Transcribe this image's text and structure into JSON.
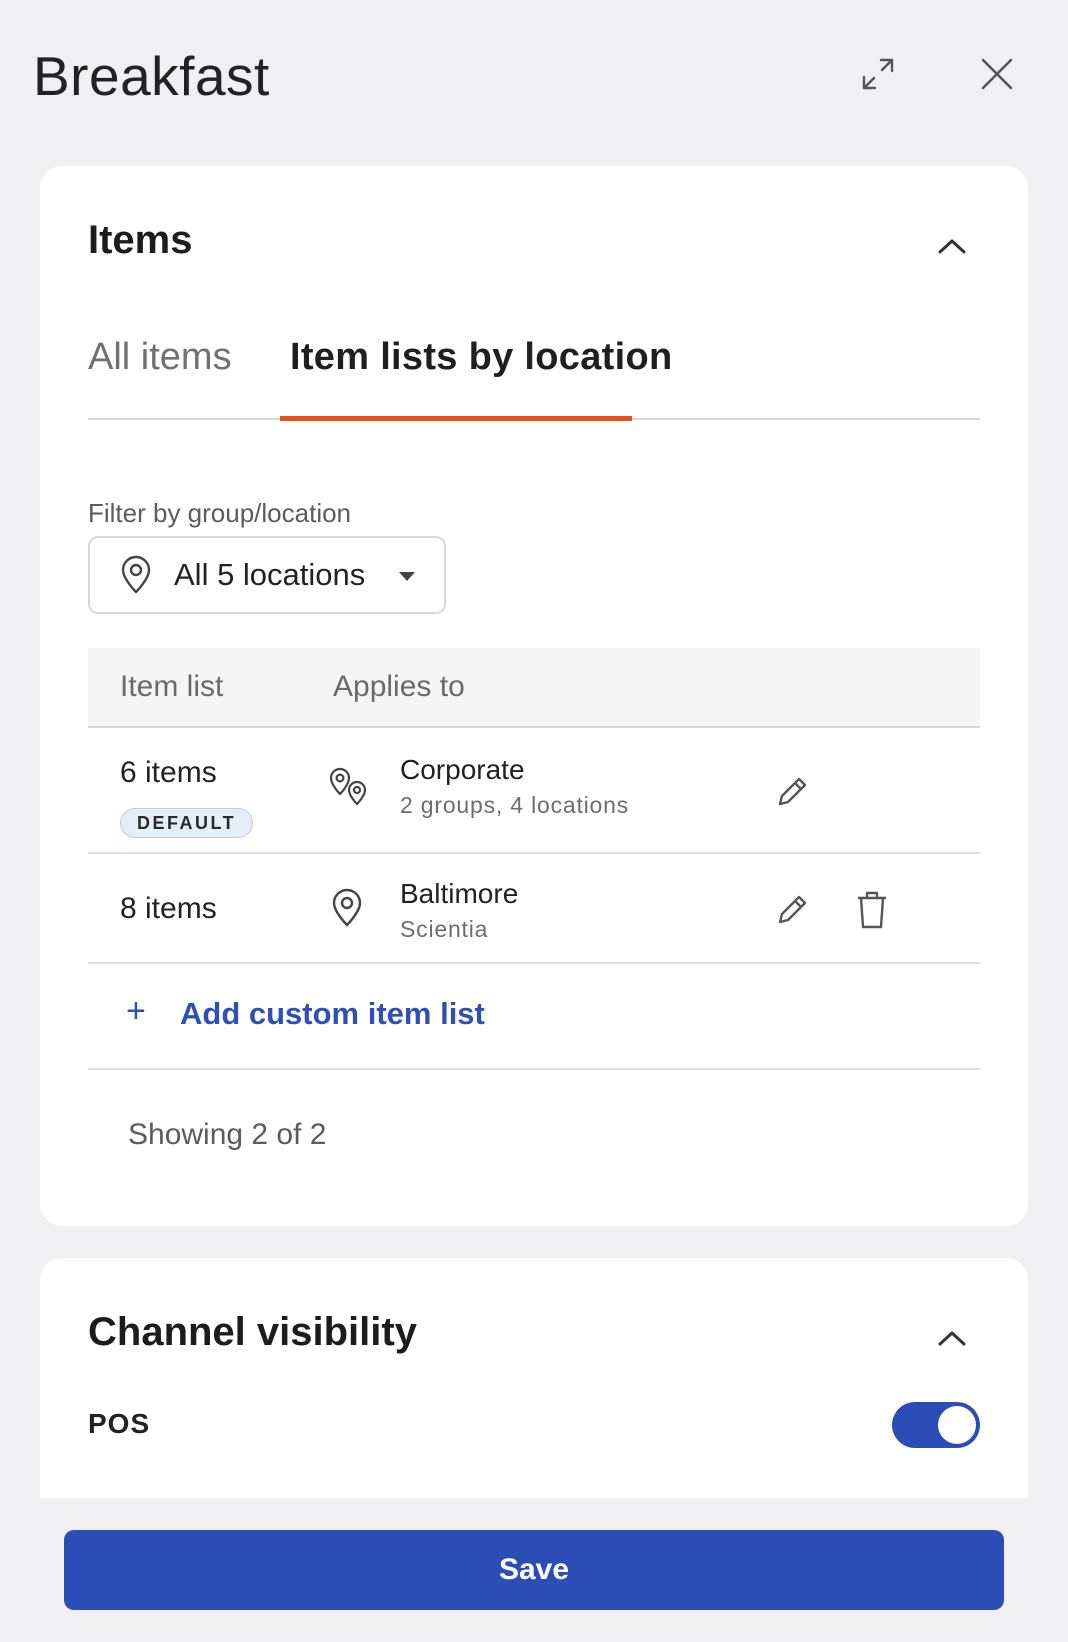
{
  "header": {
    "title": "Breakfast",
    "expand_icon": "expand-icon",
    "close_icon": "close-icon"
  },
  "items_section": {
    "title": "Items",
    "tabs": [
      {
        "label": "All items",
        "active": false
      },
      {
        "label": "Item lists by location",
        "active": true
      }
    ],
    "filter": {
      "label": "Filter by group/location",
      "value": "All 5 locations"
    },
    "table": {
      "columns": [
        "Item list",
        "Applies to"
      ],
      "rows": [
        {
          "count": "6 items",
          "badge": "DEFAULT",
          "name": "Corporate",
          "sub": "2 groups, 4 locations",
          "icon": "multi-location-icon",
          "actions": [
            "edit"
          ]
        },
        {
          "count": "8 items",
          "badge": "",
          "name": "Baltimore",
          "sub": "Scientia",
          "icon": "location-pin-icon",
          "actions": [
            "edit",
            "delete"
          ]
        }
      ],
      "add_label": "Add custom item list",
      "showing": "Showing 2 of 2"
    }
  },
  "channel_section": {
    "title": "Channel visibility",
    "pos_label": "POS",
    "pos_enabled": true
  },
  "footer": {
    "save_label": "Save"
  },
  "colors": {
    "accent": "#2d4db6",
    "tab_underline": "#e8501c",
    "background": "#f0f0f2"
  }
}
